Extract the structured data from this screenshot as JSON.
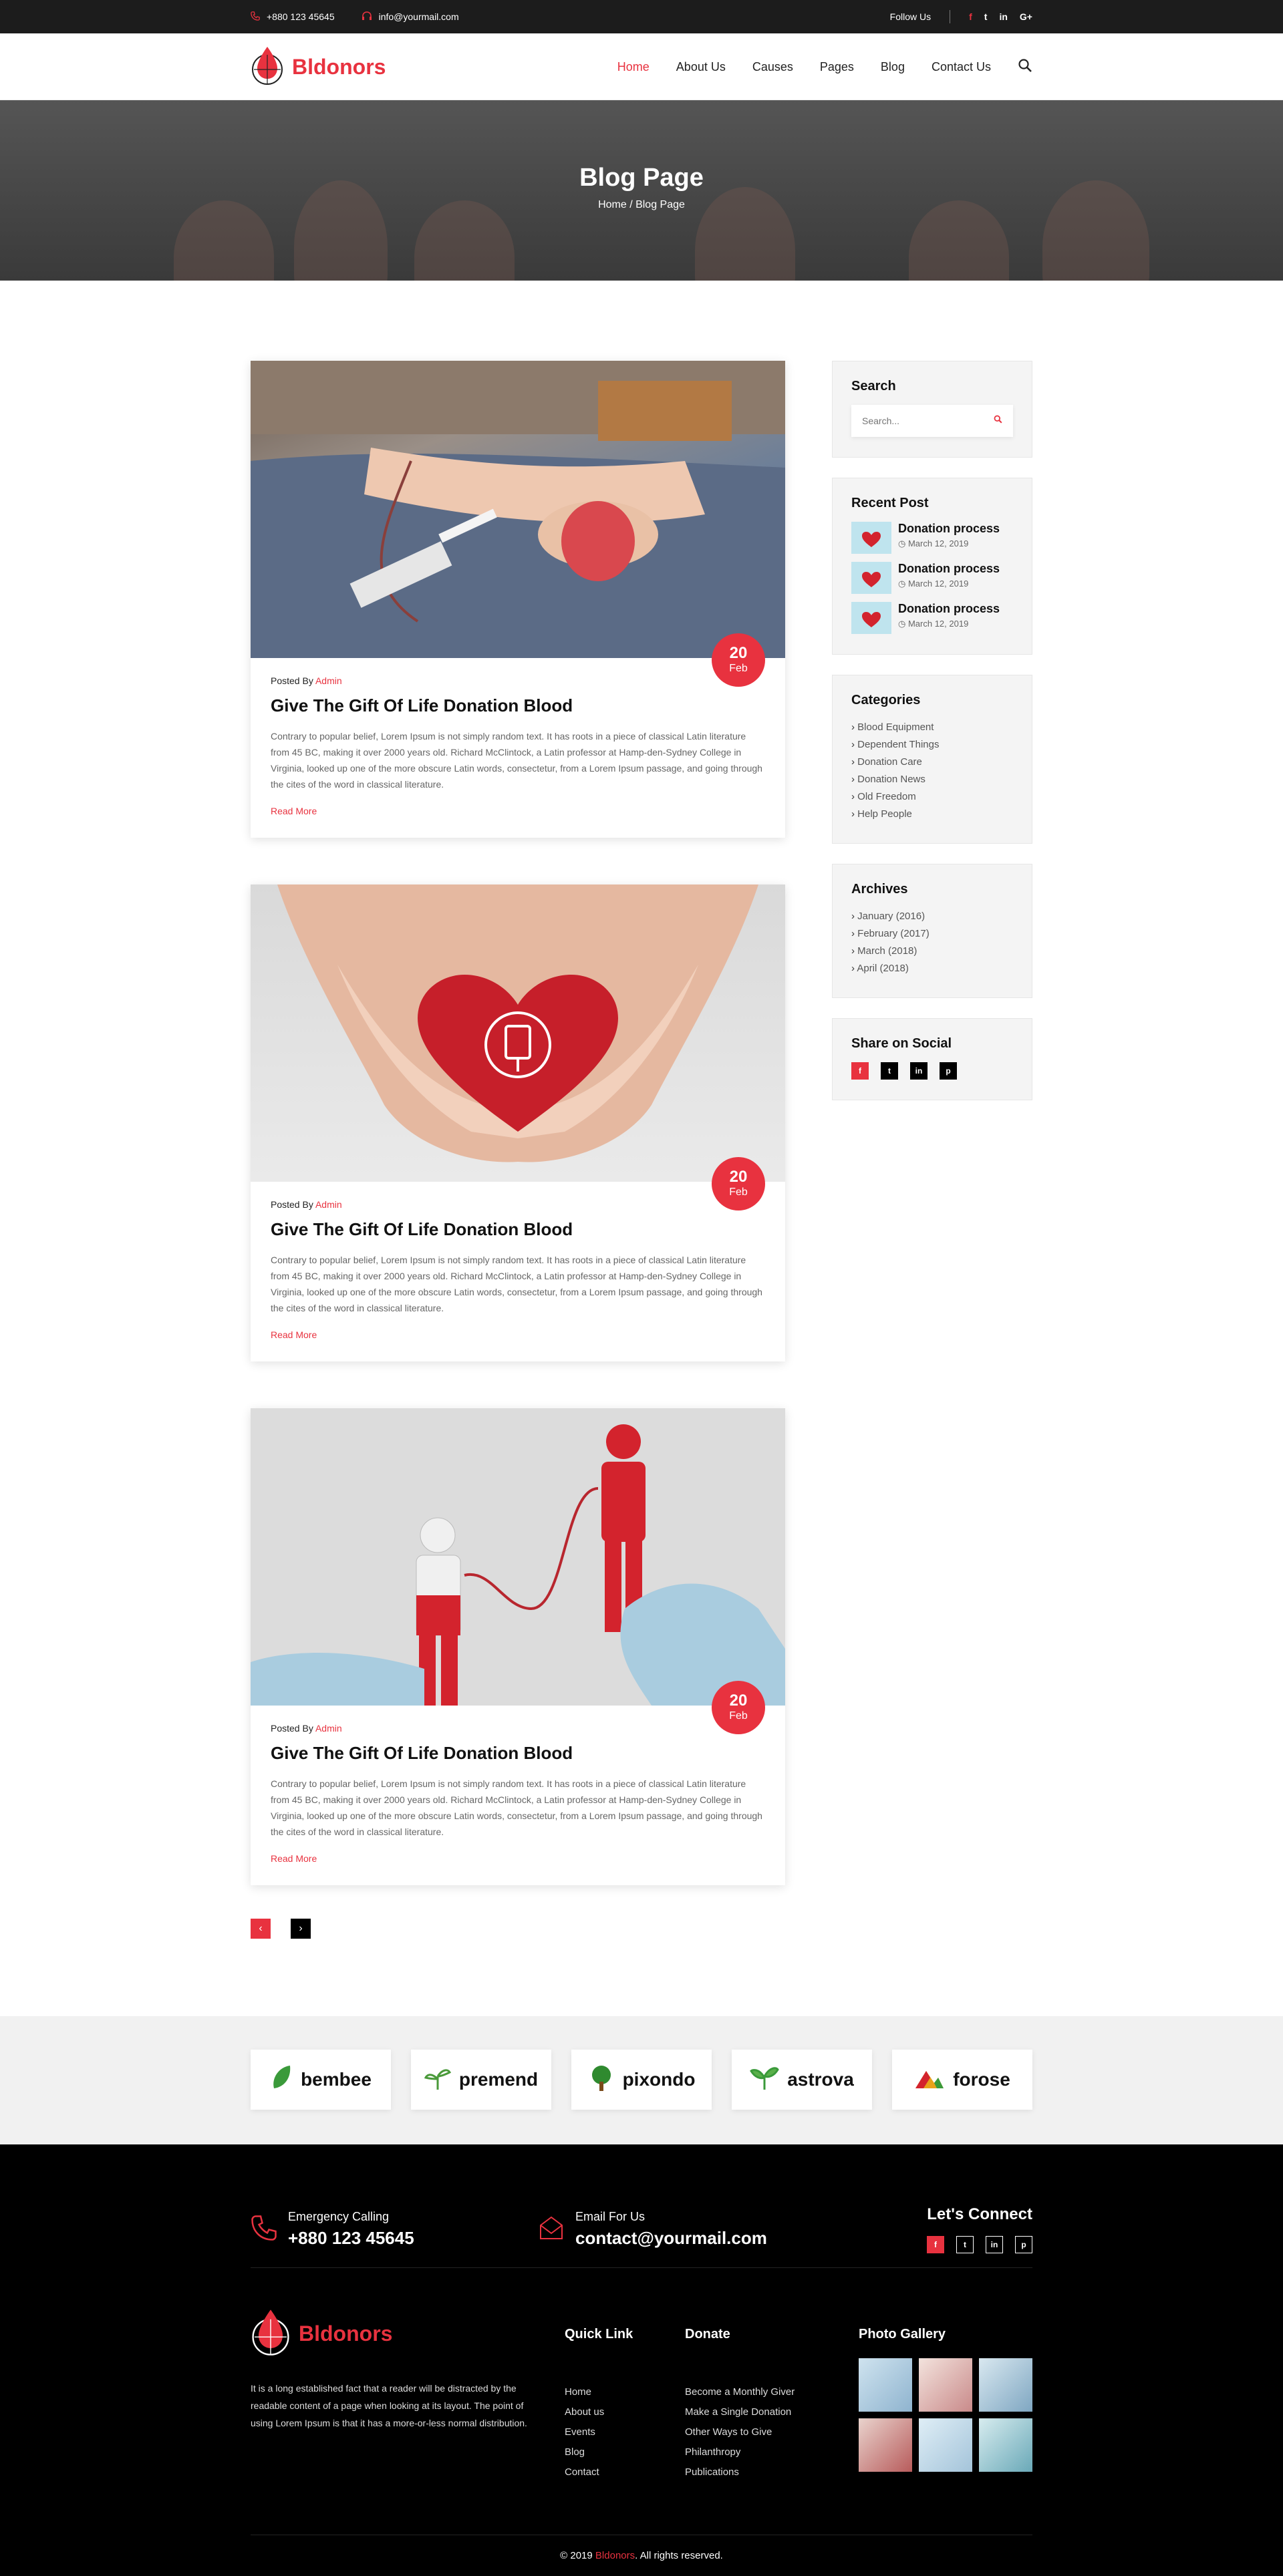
{
  "topbar": {
    "phone": "+880 123 45645",
    "email": "info@yourmail.com",
    "follow_label": "Follow Us",
    "social": [
      "f",
      "t",
      "in",
      "G+"
    ]
  },
  "header": {
    "brand": "Bldonors",
    "nav": [
      "Home",
      "About Us",
      "Causes",
      "Pages",
      "Blog",
      "Contact Us"
    ]
  },
  "hero": {
    "title": "Blog Page",
    "breadcrumb": "Home / Blog Page"
  },
  "posts": [
    {
      "posted_by": "Posted By",
      "author": "Admin",
      "title": "Give The Gift Of Life Donation Blood",
      "excerpt": "Contrary to popular belief, Lorem Ipsum is not simply random text. It has roots in a piece of classical Latin literature from 45 BC, making it over 2000 years old. Richard McClintock, a Latin professor at Hamp-den-Sydney College in Virginia, looked up one of the more obscure Latin words, consectetur, from a Lorem Ipsum passage, and going through the cites of the word in classical literature.",
      "read_more": "Read More",
      "day": "20",
      "month": "Feb"
    },
    {
      "posted_by": "Posted By",
      "author": "Admin",
      "title": "Give The Gift Of Life Donation Blood",
      "excerpt": "Contrary to popular belief, Lorem Ipsum is not simply random text. It has roots in a piece of classical Latin literature from 45 BC, making it over 2000 years old. Richard McClintock, a Latin professor at Hamp-den-Sydney College in Virginia, looked up one of the more obscure Latin words, consectetur, from a Lorem Ipsum passage, and going through the cites of the word in classical literature.",
      "read_more": "Read More",
      "day": "20",
      "month": "Feb"
    },
    {
      "posted_by": "Posted By",
      "author": "Admin",
      "title": "Give The Gift Of Life Donation Blood",
      "excerpt": "Contrary to popular belief, Lorem Ipsum is not simply random text. It has roots in a piece of classical Latin literature from 45 BC, making it over 2000 years old. Richard McClintock, a Latin professor at Hamp-den-Sydney College in Virginia, looked up one of the more obscure Latin words, consectetur, from a Lorem Ipsum passage, and going through the cites of the word in classical literature.",
      "read_more": "Read More",
      "day": "20",
      "month": "Feb"
    }
  ],
  "pager": {
    "prev": "‹",
    "next": "›"
  },
  "sidebar": {
    "search_title": "Search",
    "search_placeholder": "Search...",
    "recent_title": "Recent Post",
    "recent": [
      {
        "title": "Donation process",
        "date": "March 12, 2019"
      },
      {
        "title": "Donation process",
        "date": "March 12, 2019"
      },
      {
        "title": "Donation process",
        "date": "March 12, 2019"
      }
    ],
    "categories_title": "Categories",
    "categories": [
      "Blood Equipment",
      "Dependent Things",
      "Donation Care",
      "Donation News",
      "Old Freedom",
      "Help People"
    ],
    "archives_title": "Archives",
    "archives": [
      "January (2016)",
      "February (2017)",
      "March (2018)",
      "April (2018)"
    ],
    "share_title": "Share on Social",
    "share": [
      "f",
      "t",
      "in",
      "p"
    ]
  },
  "brands": [
    "bembee",
    "premend",
    "pixondo",
    "astrova",
    "forose"
  ],
  "footer": {
    "emergency_label": "Emergency Calling",
    "emergency_value": "+880 123 45645",
    "email_label": "Email For Us",
    "email_value": "contact@yourmail.com",
    "connect_title": "Let's Connect",
    "connect_social": [
      "f",
      "t",
      "in",
      "p"
    ],
    "brand": "Bldonors",
    "about": "It is a long established fact that a reader will be distracted by the readable content of a page when looking at its layout. The point of using Lorem Ipsum is that it has a more-or-less normal distribution.",
    "quick_title": "Quick Link",
    "quick": [
      "Home",
      "About us",
      "Events",
      "Blog",
      "Contact"
    ],
    "donate_title": "Donate",
    "donate": [
      "Become a Monthly Giver",
      "Make a Single Donation",
      "Other Ways to Give",
      "Philanthropy",
      "Publications"
    ],
    "gallery_title": "Photo Gallery",
    "copy_pre": "© 2019",
    "copy_brand": "Bldonors",
    "copy_post": ". All rights reserved."
  },
  "colors": {
    "accent": "#e8323f",
    "dark": "#1c1c1c"
  }
}
